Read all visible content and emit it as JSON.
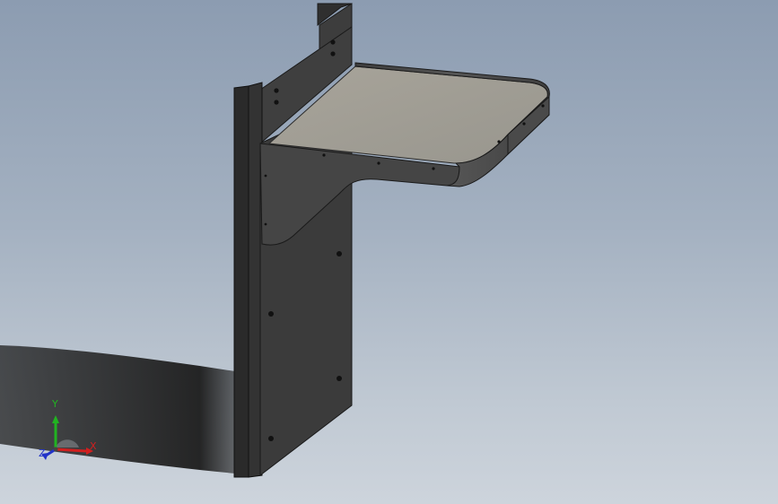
{
  "viewport": {
    "background_top": "#8c9cb1",
    "background_bottom": "#cdd4dc"
  },
  "model": {
    "part_color": "#3a3a3a",
    "shelf_top_color": "#a3a098",
    "edge_color": "#1a1a1a"
  },
  "triad": {
    "y_label": "Y",
    "x_label": "X",
    "z_label": "Z",
    "x_color": "#d11f1f",
    "y_color": "#21b321",
    "z_color": "#2233c8"
  }
}
